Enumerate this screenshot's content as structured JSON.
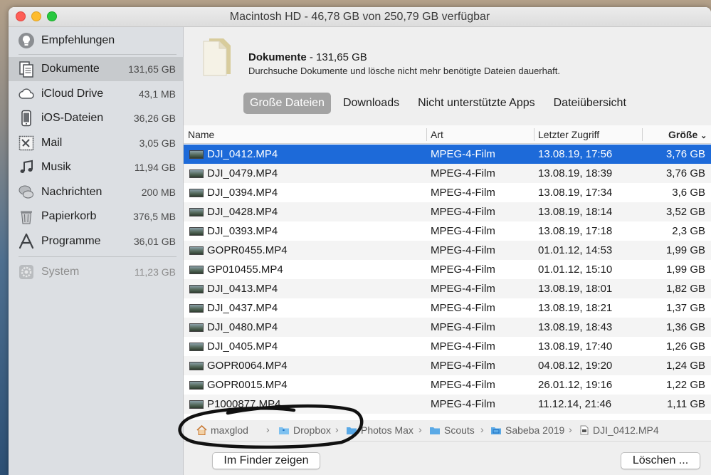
{
  "window": {
    "title": "Macintosh HD - 46,78 GB von 250,79 GB verfügbar"
  },
  "sidebar": {
    "items": [
      {
        "label": "Empfehlungen",
        "size": ""
      },
      {
        "label": "Dokumente",
        "size": "131,65 GB"
      },
      {
        "label": "iCloud Drive",
        "size": "43,1 MB"
      },
      {
        "label": "iOS-Dateien",
        "size": "36,26 GB"
      },
      {
        "label": "Mail",
        "size": "3,05 GB"
      },
      {
        "label": "Musik",
        "size": "11,94 GB"
      },
      {
        "label": "Nachrichten",
        "size": "200 MB"
      },
      {
        "label": "Papierkorb",
        "size": "376,5 MB"
      },
      {
        "label": "Programme",
        "size": "36,01 GB"
      },
      {
        "label": "System",
        "size": "11,23 GB"
      }
    ]
  },
  "header": {
    "title": "Dokumente",
    "size": "131,65 GB",
    "subtitle": "Durchsuche Dokumente und lösche nicht mehr benötigte Dateien dauerhaft."
  },
  "tabs": [
    "Große Dateien",
    "Downloads",
    "Nicht unterstützte Apps",
    "Dateiübersicht"
  ],
  "table": {
    "columns": [
      "Name",
      "Art",
      "Letzter Zugriff",
      "Größe"
    ],
    "rows": [
      {
        "name": "DJI_0412.MP4",
        "kind": "MPEG-4-Film",
        "accessed": "13.08.19, 17:56",
        "size": "3,76 GB"
      },
      {
        "name": "DJI_0479.MP4",
        "kind": "MPEG-4-Film",
        "accessed": "13.08.19, 18:39",
        "size": "3,76 GB"
      },
      {
        "name": "DJI_0394.MP4",
        "kind": "MPEG-4-Film",
        "accessed": "13.08.19, 17:34",
        "size": "3,6 GB"
      },
      {
        "name": "DJI_0428.MP4",
        "kind": "MPEG-4-Film",
        "accessed": "13.08.19, 18:14",
        "size": "3,52 GB"
      },
      {
        "name": "DJI_0393.MP4",
        "kind": "MPEG-4-Film",
        "accessed": "13.08.19, 17:18",
        "size": "2,3 GB"
      },
      {
        "name": "GOPR0455.MP4",
        "kind": "MPEG-4-Film",
        "accessed": "01.01.12, 14:53",
        "size": "1,99 GB"
      },
      {
        "name": "GP010455.MP4",
        "kind": "MPEG-4-Film",
        "accessed": "01.01.12, 15:10",
        "size": "1,99 GB"
      },
      {
        "name": "DJI_0413.MP4",
        "kind": "MPEG-4-Film",
        "accessed": "13.08.19, 18:01",
        "size": "1,82 GB"
      },
      {
        "name": "DJI_0437.MP4",
        "kind": "MPEG-4-Film",
        "accessed": "13.08.19, 18:21",
        "size": "1,37 GB"
      },
      {
        "name": "DJI_0480.MP4",
        "kind": "MPEG-4-Film",
        "accessed": "13.08.19, 18:43",
        "size": "1,36 GB"
      },
      {
        "name": "DJI_0405.MP4",
        "kind": "MPEG-4-Film",
        "accessed": "13.08.19, 17:40",
        "size": "1,26 GB"
      },
      {
        "name": "GOPR0064.MP4",
        "kind": "MPEG-4-Film",
        "accessed": "04.08.12, 19:20",
        "size": "1,24 GB"
      },
      {
        "name": "GOPR0015.MP4",
        "kind": "MPEG-4-Film",
        "accessed": "26.01.12, 19:16",
        "size": "1,22 GB"
      },
      {
        "name": "P1000877.MP4",
        "kind": "MPEG-4-Film",
        "accessed": "11.12.14, 21:46",
        "size": "1,11 GB"
      }
    ]
  },
  "path": [
    "maxglod",
    "Dropbox",
    "Photos Max",
    "Scouts",
    "Sabeba 2019",
    "DJI_0412.MP4"
  ],
  "buttons": {
    "finder": "Im Finder zeigen",
    "delete": "Löschen ..."
  },
  "colors": {
    "selection": "#1d6ad9",
    "folder": "#5aa9e6",
    "annotation": "#111111"
  }
}
